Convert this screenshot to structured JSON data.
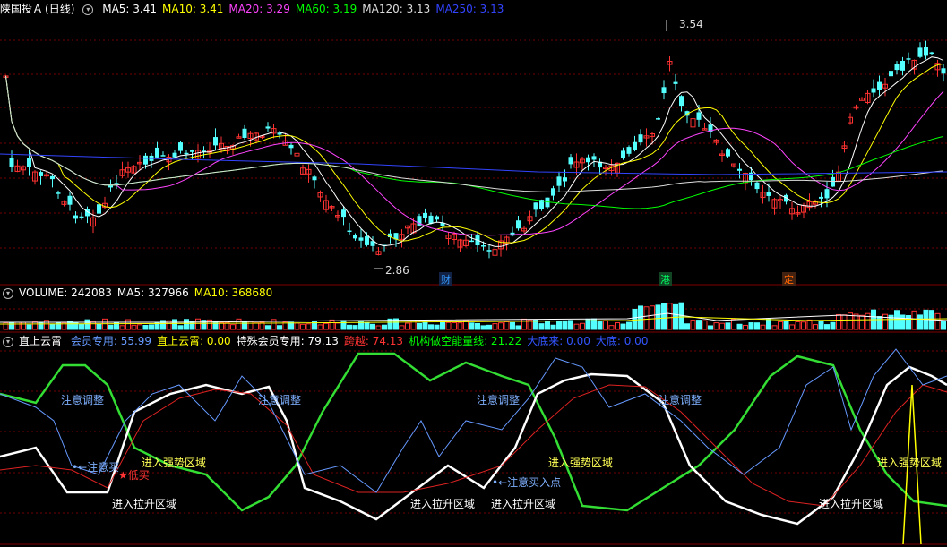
{
  "stock": {
    "name": "陕国投Ａ",
    "period": "(日线)"
  },
  "main_ma": [
    {
      "label": "MA5: ",
      "value": "3.41",
      "color": "#ffffff"
    },
    {
      "label": "MA10: ",
      "value": "3.41",
      "color": "#ffff00"
    },
    {
      "label": "MA20: ",
      "value": "3.29",
      "color": "#ff44ff"
    },
    {
      "label": "MA60: ",
      "value": "3.19",
      "color": "#00ff00"
    },
    {
      "label": "MA120: ",
      "value": "3.13",
      "color": "#dddddd"
    },
    {
      "label": "MA250: ",
      "value": "3.13",
      "color": "#3344ff"
    }
  ],
  "price_marks": {
    "high": "3.54",
    "low": "2.86"
  },
  "event_tags": [
    {
      "text": "财",
      "color": "#3399ff"
    },
    {
      "text": "港",
      "color": "#00cc44"
    },
    {
      "text": "定",
      "color": "#ff6600"
    }
  ],
  "volume_header": [
    {
      "label": "VOLUME: ",
      "value": "242083",
      "color": "#ffffff"
    },
    {
      "label": "MA5: ",
      "value": "327966",
      "color": "#ffffff"
    },
    {
      "label": "MA10: ",
      "value": "368680",
      "color": "#ffff00"
    }
  ],
  "indicator_header": {
    "name": "直上云霄",
    "items": [
      {
        "label": "会员专用: ",
        "value": "55.99",
        "color": "#6699ff"
      },
      {
        "label": "直上云霄: ",
        "value": "0.00",
        "color": "#ffff00"
      },
      {
        "label": "特殊会员专用: ",
        "value": "79.13",
        "color": "#ffffff"
      },
      {
        "label": "跨越: ",
        "value": "74.13",
        "color": "#ff3333"
      },
      {
        "label": "机构做空能量线: ",
        "value": "21.22",
        "color": "#00ff00"
      },
      {
        "label": "大底来: ",
        "value": "0.00",
        "color": "#3355ff"
      },
      {
        "label": "大底: ",
        "value": "0.00",
        "color": "#3355ff"
      }
    ]
  },
  "annotations": {
    "attention_adjust": "注意调整",
    "enter_lift": "进入拉升区域",
    "enter_strong": "进入强势区域",
    "attention_buy": "注意买入点",
    "attention_short": "注意买",
    "low_buy": "低买"
  },
  "colors": {
    "up": "#ff3232",
    "down": "#54ffff",
    "ma5": "#ffffff",
    "ma10": "#ffff00",
    "ma20": "#ff44ff",
    "ma60": "#00ff00",
    "ma120": "#dddddd",
    "ma250": "#3344ff"
  }
}
